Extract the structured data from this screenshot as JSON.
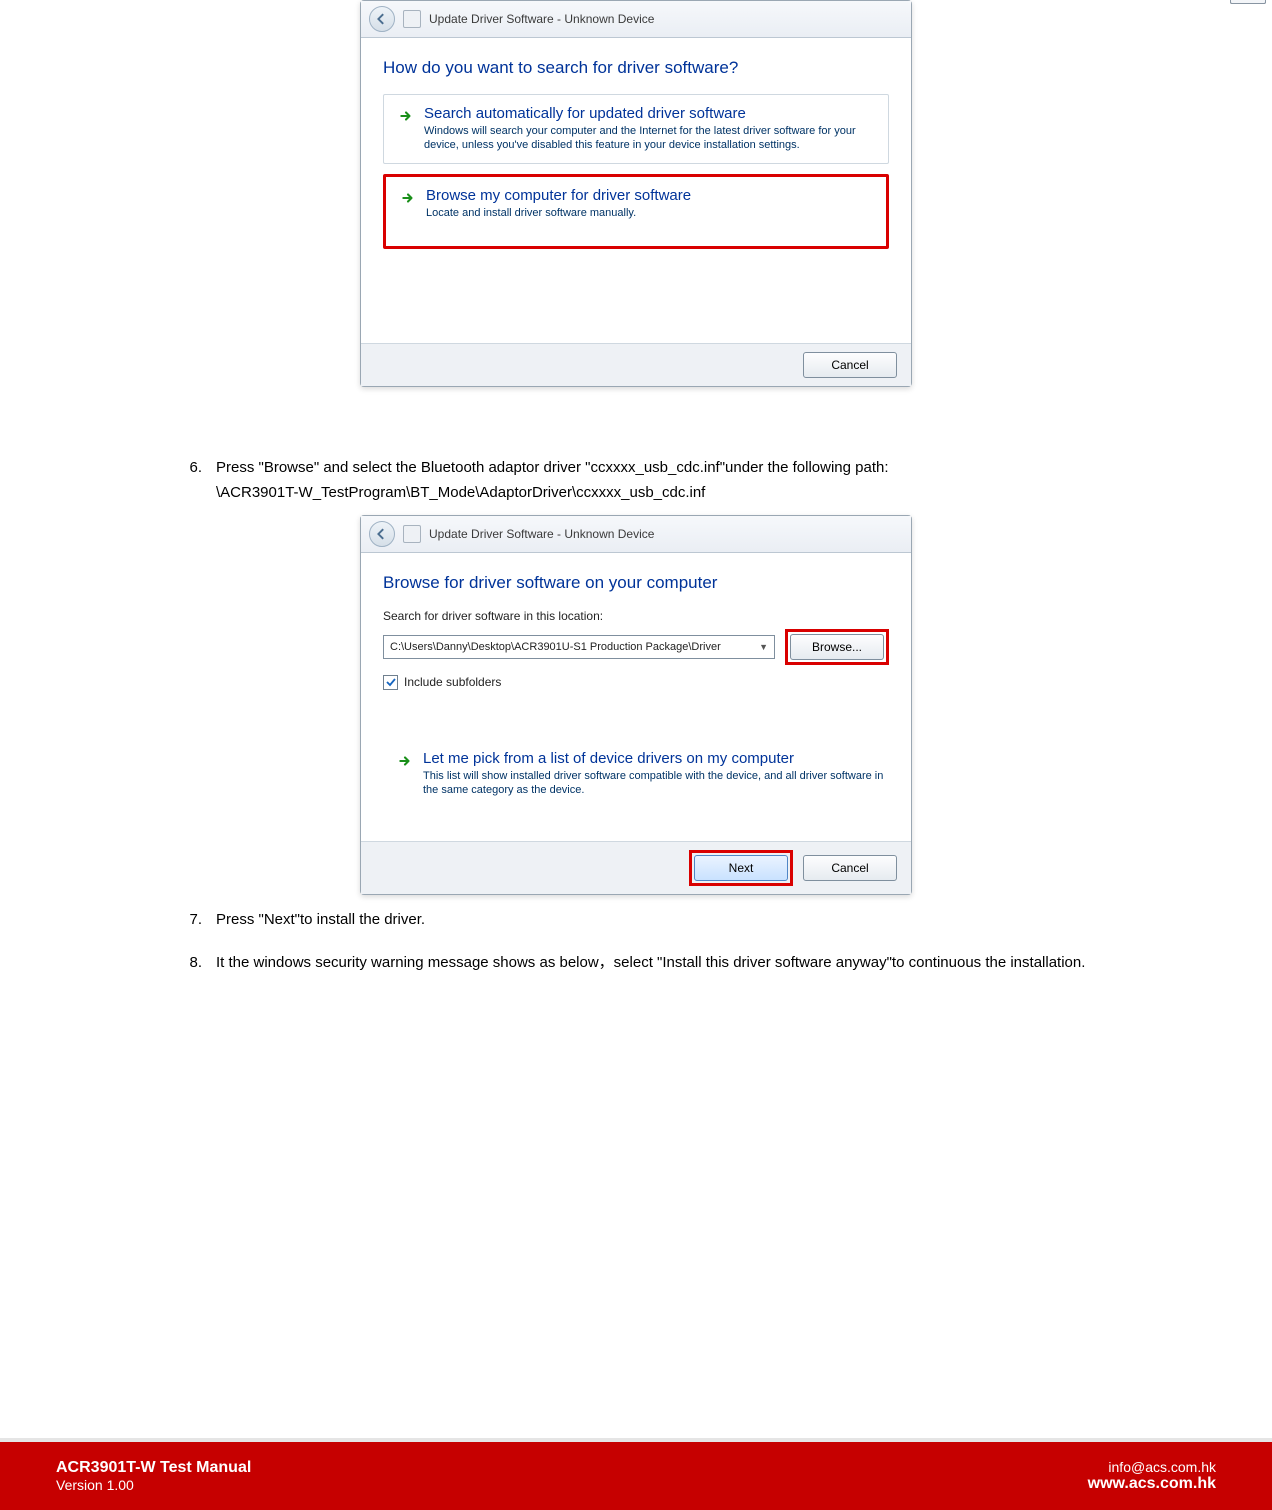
{
  "dialog1": {
    "window_title": "Update Driver Software - Unknown Device",
    "close_glyph": "⨉",
    "heading": "How do you want to search for driver software?",
    "option_auto": {
      "title": "Search automatically for updated driver software",
      "desc": "Windows will search your computer and the Internet for the latest driver software for your device, unless you've disabled this feature in your device installation settings."
    },
    "option_browse": {
      "title": "Browse my computer for driver software",
      "desc": "Locate and install driver software manually."
    },
    "cancel": "Cancel"
  },
  "step6": {
    "num": "6.",
    "text": "Press \"Browse\" and select the Bluetooth adaptor driver \"ccxxxx_usb_cdc.inf\"under the following path:",
    "path": "\\ACR3901T-W_TestProgram\\BT_Mode\\AdaptorDriver\\ccxxxx_usb_cdc.inf"
  },
  "dialog2": {
    "window_title": "Update Driver Software - Unknown Device",
    "close_glyph": "⨉",
    "heading": "Browse for driver software on your computer",
    "search_label": "Search for driver software in this location:",
    "path_value": "C:\\Users\\Danny\\Desktop\\ACR3901U-S1 Production Package\\Driver",
    "browse_btn": "Browse...",
    "include_subfolders": "Include subfolders",
    "pick_title": "Let me pick from a list of device drivers on my computer",
    "pick_desc": "This list will show installed driver software compatible with the device, and all driver software in the same category as the device.",
    "next": "Next",
    "cancel": "Cancel"
  },
  "step7": {
    "num": "7.",
    "text": "Press \"Next\"to install the driver."
  },
  "step8": {
    "num": "8.",
    "text": "It the windows security warning message shows as below，select \"Install this driver software anyway\"to continuous the installation."
  },
  "footer": {
    "title": "ACR3901T-W Test Manual",
    "version": "Version 1.00",
    "email": "info@acs.com.hk",
    "website": "www.acs.com.hk"
  }
}
